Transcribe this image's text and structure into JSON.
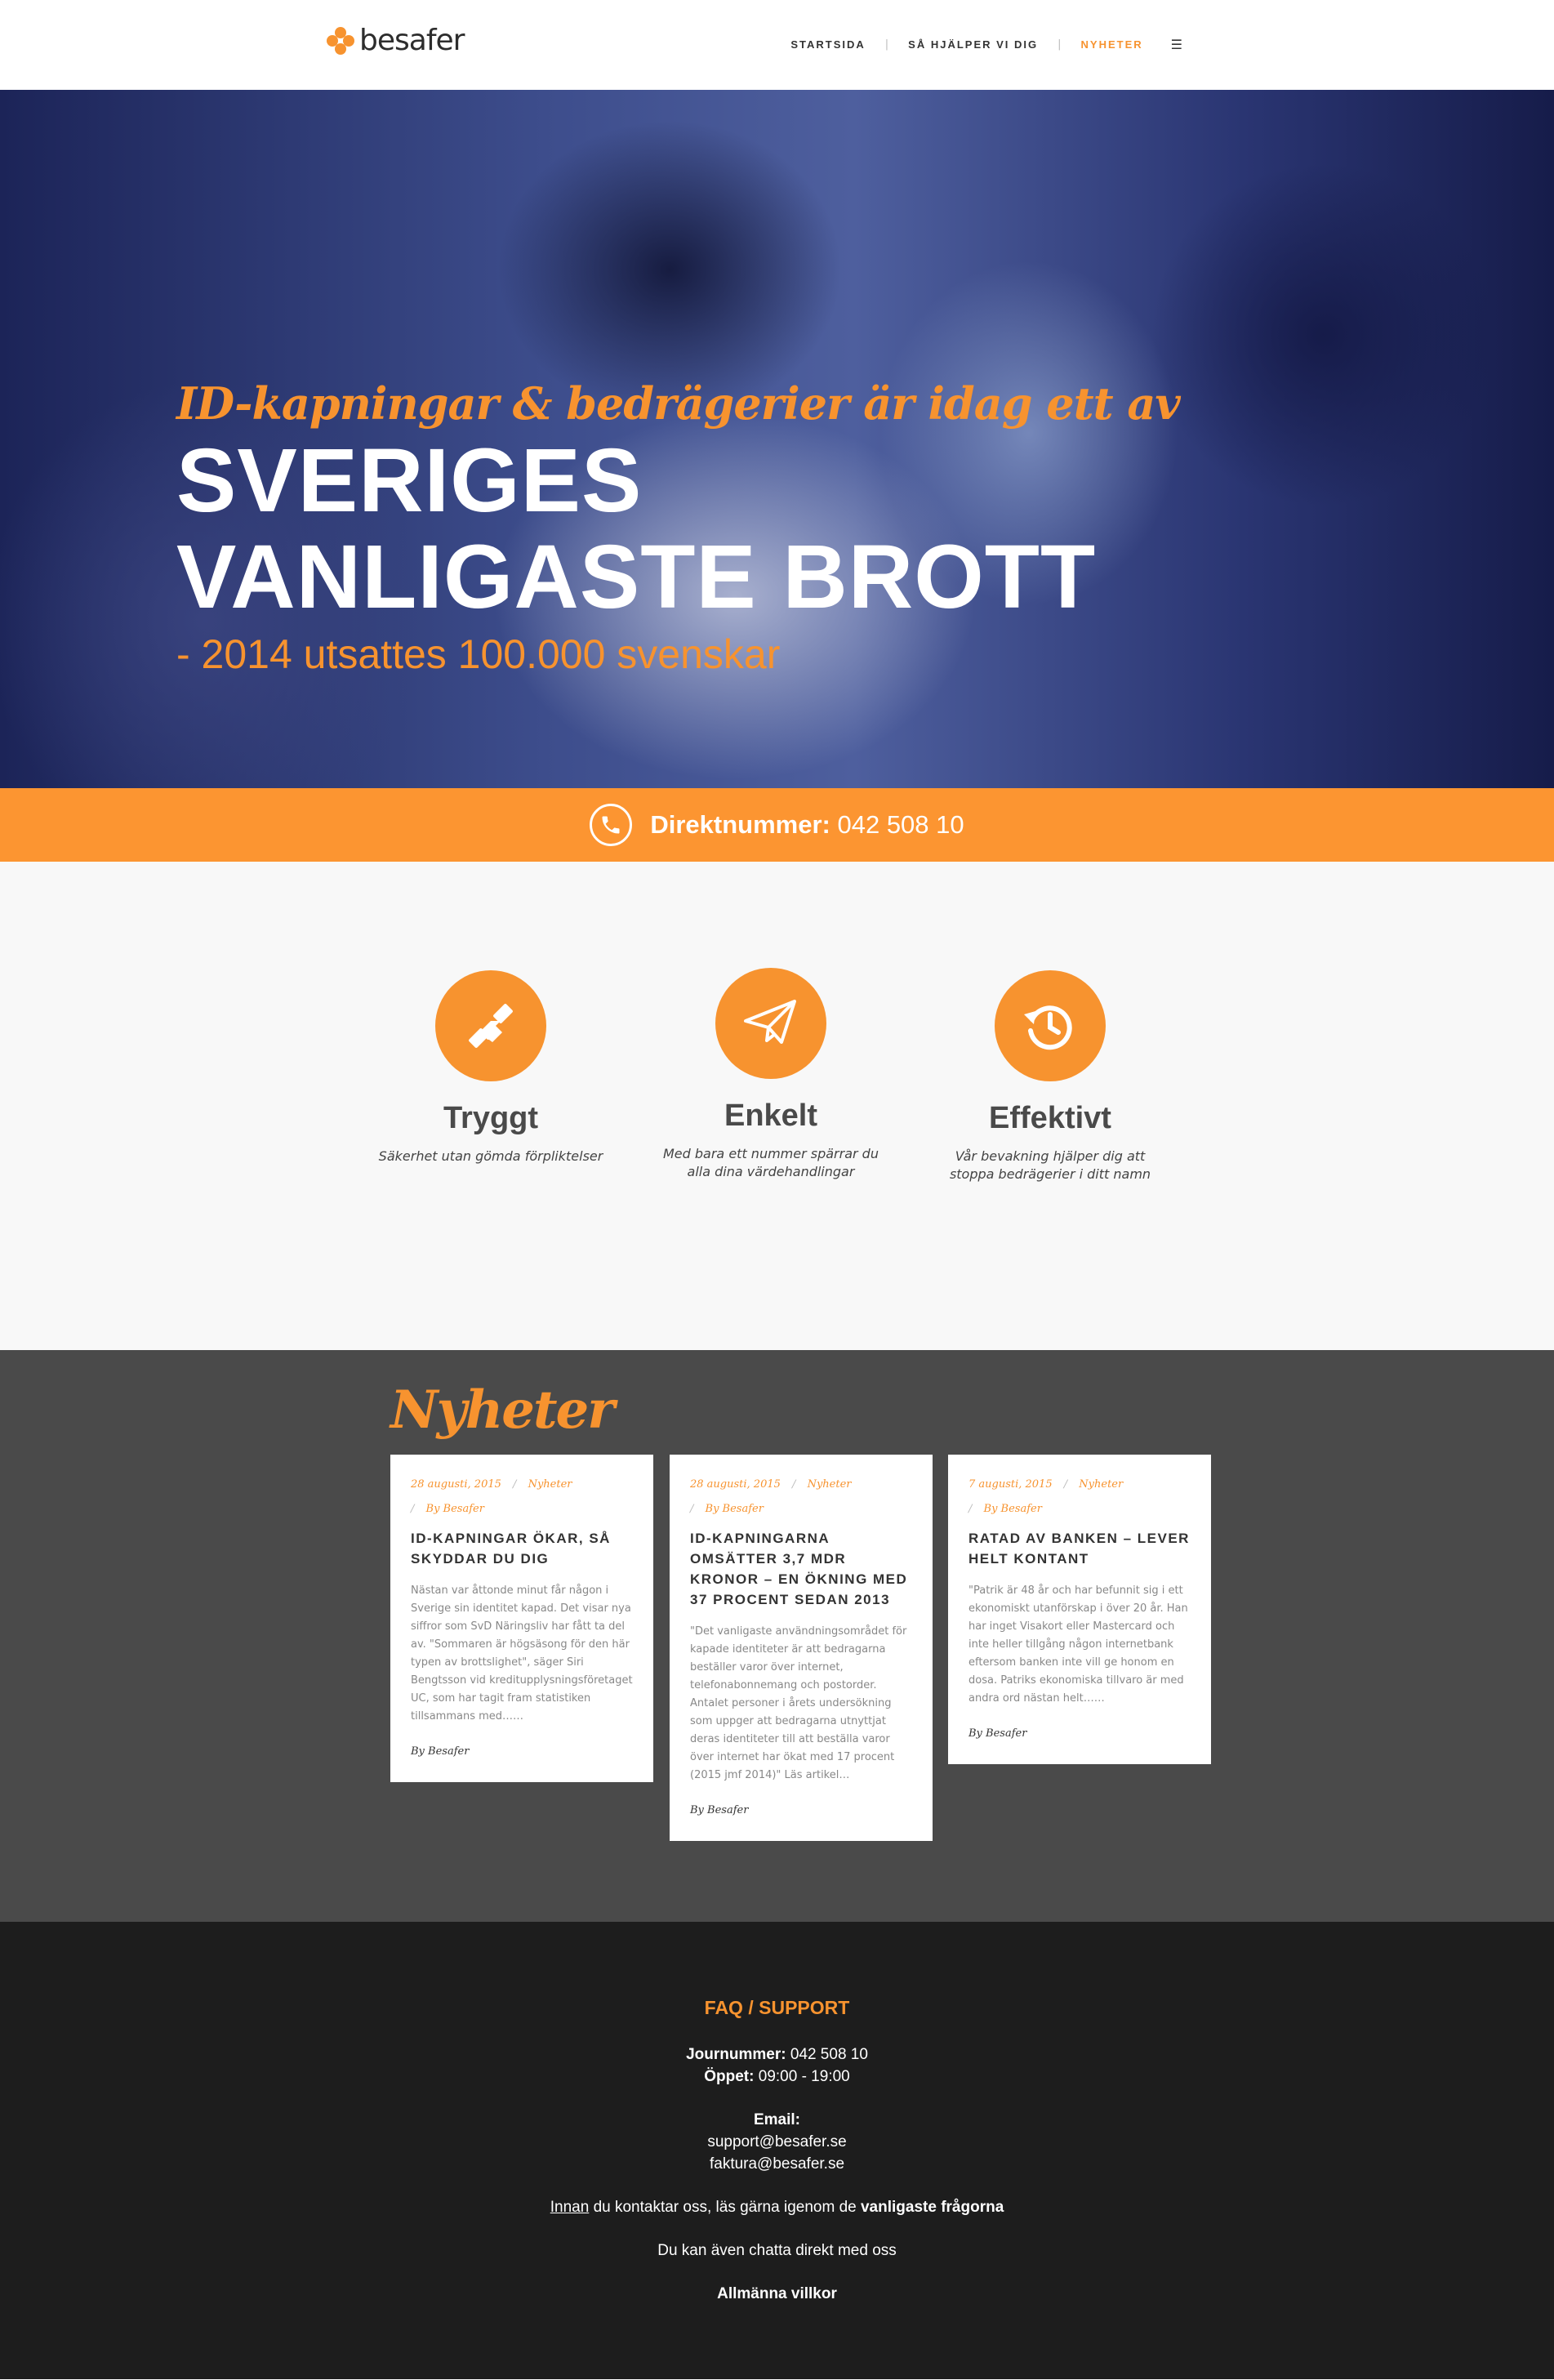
{
  "header": {
    "logo_text": "besafer",
    "nav": [
      {
        "label": "STARTSIDA"
      },
      {
        "label": "SÅ HJÄLPER VI DIG"
      },
      {
        "label": "NYHETER"
      }
    ],
    "menu_icon": "hamburger-icon",
    "accent_color": "#f7932f"
  },
  "hero": {
    "script_line": "ID-kapningar & bedrägerier är idag ett av",
    "title_line1": "SVERIGES",
    "title_line2": "VANLIGASTE BROTT",
    "subtitle": "- 2014 utsattes 100.000 svenskar"
  },
  "phone_strip": {
    "icon": "phone-icon",
    "label": "Direktnummer:",
    "number": "042 508 10"
  },
  "features": [
    {
      "icon": "handshake-icon",
      "title": "Tryggt",
      "text": "Säkerhet utan gömda förpliktelser"
    },
    {
      "icon": "paper-plane-icon",
      "title": "Enkelt",
      "text": "Med bara ett nummer spärrar du alla dina värdehandlingar"
    },
    {
      "icon": "history-clock-icon",
      "title": "Effektivt",
      "text": "Vår bevakning hjälper dig att stoppa bedrägerier i ditt namn"
    }
  ],
  "news": {
    "heading": "Nyheter",
    "cards": [
      {
        "date": "28 augusti, 2015",
        "category": "Nyheter",
        "author_meta": "By Besafer",
        "title": "ID-KAPNINGAR ÖKAR, SÅ SKYDDAR DU DIG",
        "excerpt": "Nästan var åttonde minut får någon i Sverige sin identitet kapad. Det visar nya siffror som SvD Näringsliv har fått ta del av. \"Sommaren är högsäsong för den här typen av brottslighet\", säger Siri Bengtsson vid kreditupplysningsföretaget UC, som har tagit fram statistiken tillsammans med……",
        "author": "By Besafer"
      },
      {
        "date": "28 augusti, 2015",
        "category": "Nyheter",
        "author_meta": "By Besafer",
        "title": "ID-KAPNINGARNA OMSÄTTER 3,7 MDR KRONOR – EN ÖKNING MED 37 PROCENT SEDAN 2013",
        "excerpt": "\"Det vanligaste användningsområdet för kapade identiteter är att bedragarna beställer varor över internet, telefonabonnemang och postorder. Antalet personer i årets undersökning som uppger att bedragarna utnyttjat deras identiteter till att beställa varor över internet har ökat med 17 procent (2015 jmf 2014)\" Läs artikel…",
        "author": "By Besafer"
      },
      {
        "date": "7 augusti, 2015",
        "category": "Nyheter",
        "author_meta": "By Besafer",
        "title": "RATAD AV BANKEN – LEVER HELT KONTANT",
        "excerpt": "\"Patrik är 48 år och har befunnit sig i ett ekonomiskt utanförskap i över 20 år. Han har inget Visakort eller Mastercard och inte heller tillgång någon internetbank eftersom banken inte vill ge honom en dosa. Patriks ekonomiska tillvaro är med andra ord nästan helt……",
        "author": "By Besafer"
      }
    ]
  },
  "footer": {
    "heading": "FAQ / SUPPORT",
    "journummer_label": "Journummer:",
    "journummer_value": "042 508 10",
    "open_label": "Öppet:",
    "open_value": "09:00 - 19:00",
    "email_label": "Email:",
    "email_support": "support@besafer.se",
    "email_faktura": "faktura@besafer.se",
    "faq_link_innan": "Innan",
    "faq_text_middle": "du kontaktar oss, läs gärna igenom de",
    "faq_link_bold": "vanligaste frågorna",
    "chat_text": "Du kan även chatta direkt med oss",
    "terms_link": "Allmänna villkor"
  }
}
